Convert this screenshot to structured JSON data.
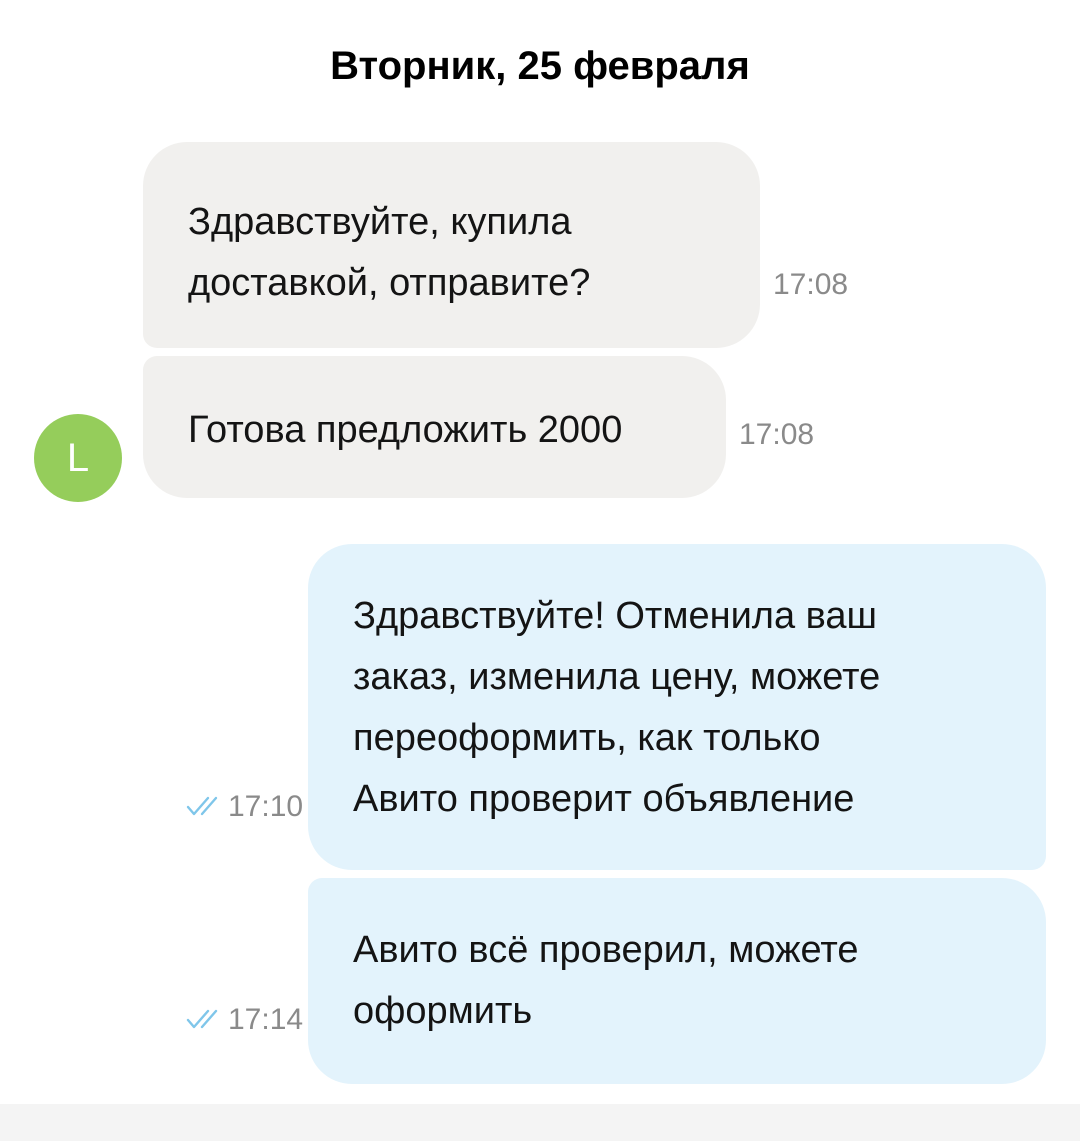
{
  "chat": {
    "date_header": "Вторник, 25 февраля",
    "avatar_letter": "L",
    "messages": [
      {
        "direction": "incoming",
        "lines": [
          "Здравствуйте, купила",
          "доставкой, отправите?"
        ],
        "time": "17:08"
      },
      {
        "direction": "incoming",
        "lines": [
          "Готова предложить 2000"
        ],
        "time": "17:08"
      },
      {
        "direction": "outgoing",
        "lines": [
          "Здравствуйте! Отменила ваш",
          "заказ, изменила цену, можете",
          "переоформить, как только",
          "Авито проверит объявление"
        ],
        "time": "17:10",
        "status": "read"
      },
      {
        "direction": "outgoing",
        "lines": [
          "Авито всё проверил, можете",
          "оформить"
        ],
        "time": "17:14",
        "status": "read"
      }
    ]
  },
  "colors": {
    "incoming_bubble": "#f1f0ee",
    "outgoing_bubble": "#e3f3fc",
    "avatar": "#95cd5b",
    "read_ticks": "#7fc6ea",
    "time_text": "#8a8a8a"
  },
  "icons": {
    "read_status": "double-check-icon"
  }
}
